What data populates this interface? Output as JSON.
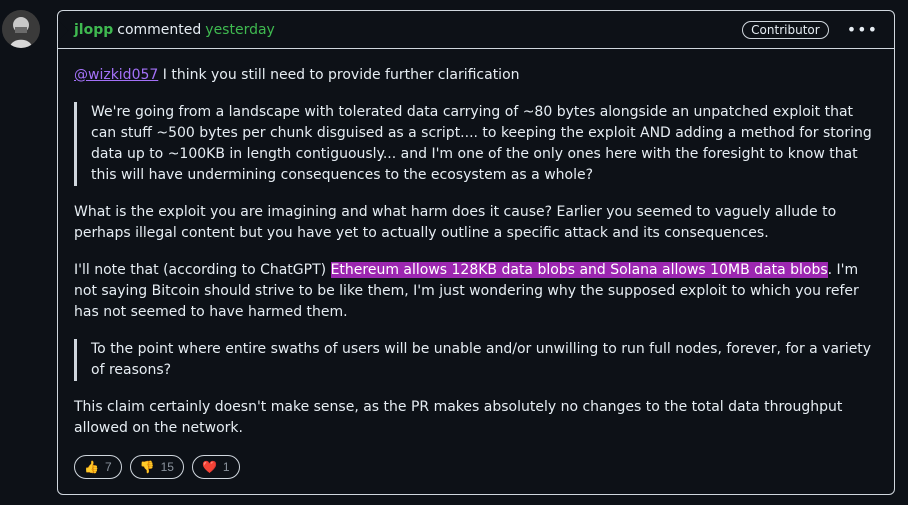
{
  "comment": {
    "author": "jlopp",
    "action": "commented",
    "time": "yesterday",
    "badge": "Contributor",
    "menu_icon": "•••",
    "paragraphs": {
      "p1_mention": "@wizkid057",
      "p1_text": " I think you still need to provide further clarification",
      "quote1": "We're going from a landscape with tolerated data carrying of ~80 bytes alongside an unpatched exploit that can stuff ~500 bytes per chunk disguised as a script.... to keeping the exploit AND adding a method for storing data up to ~100KB in length contiguously... and I'm one of the only ones here with the foresight to know that this will have undermining consequences to the ecosystem as a whole?",
      "p2": "What is the exploit you are imagining and what harm does it cause? Earlier you seemed to vaguely allude to perhaps illegal content but you have yet to actually outline a specific attack and its consequences.",
      "p3_before": "I'll note that (according to ChatGPT) ",
      "p3_highlight": "Ethereum allows 128KB data blobs and Solana allows 10MB data blobs",
      "p3_after": ". I'm not saying Bitcoin should strive to be like them, I'm just wondering why the supposed exploit to which you refer has not seemed to have harmed them.",
      "quote2": "To the point where entire swaths of users will be unable and/or unwilling to run full nodes, forever, for a variety of reasons?",
      "p4": "This claim certainly doesn't make sense, as the PR makes absolutely no changes to the total data throughput allowed on the network."
    },
    "reactions": [
      {
        "emoji": "👍",
        "icon": "thumbs-up-icon",
        "count": "7"
      },
      {
        "emoji": "👎",
        "icon": "thumbs-down-icon",
        "count": "15"
      },
      {
        "emoji": "❤️",
        "icon": "heart-icon",
        "count": "1"
      }
    ]
  }
}
